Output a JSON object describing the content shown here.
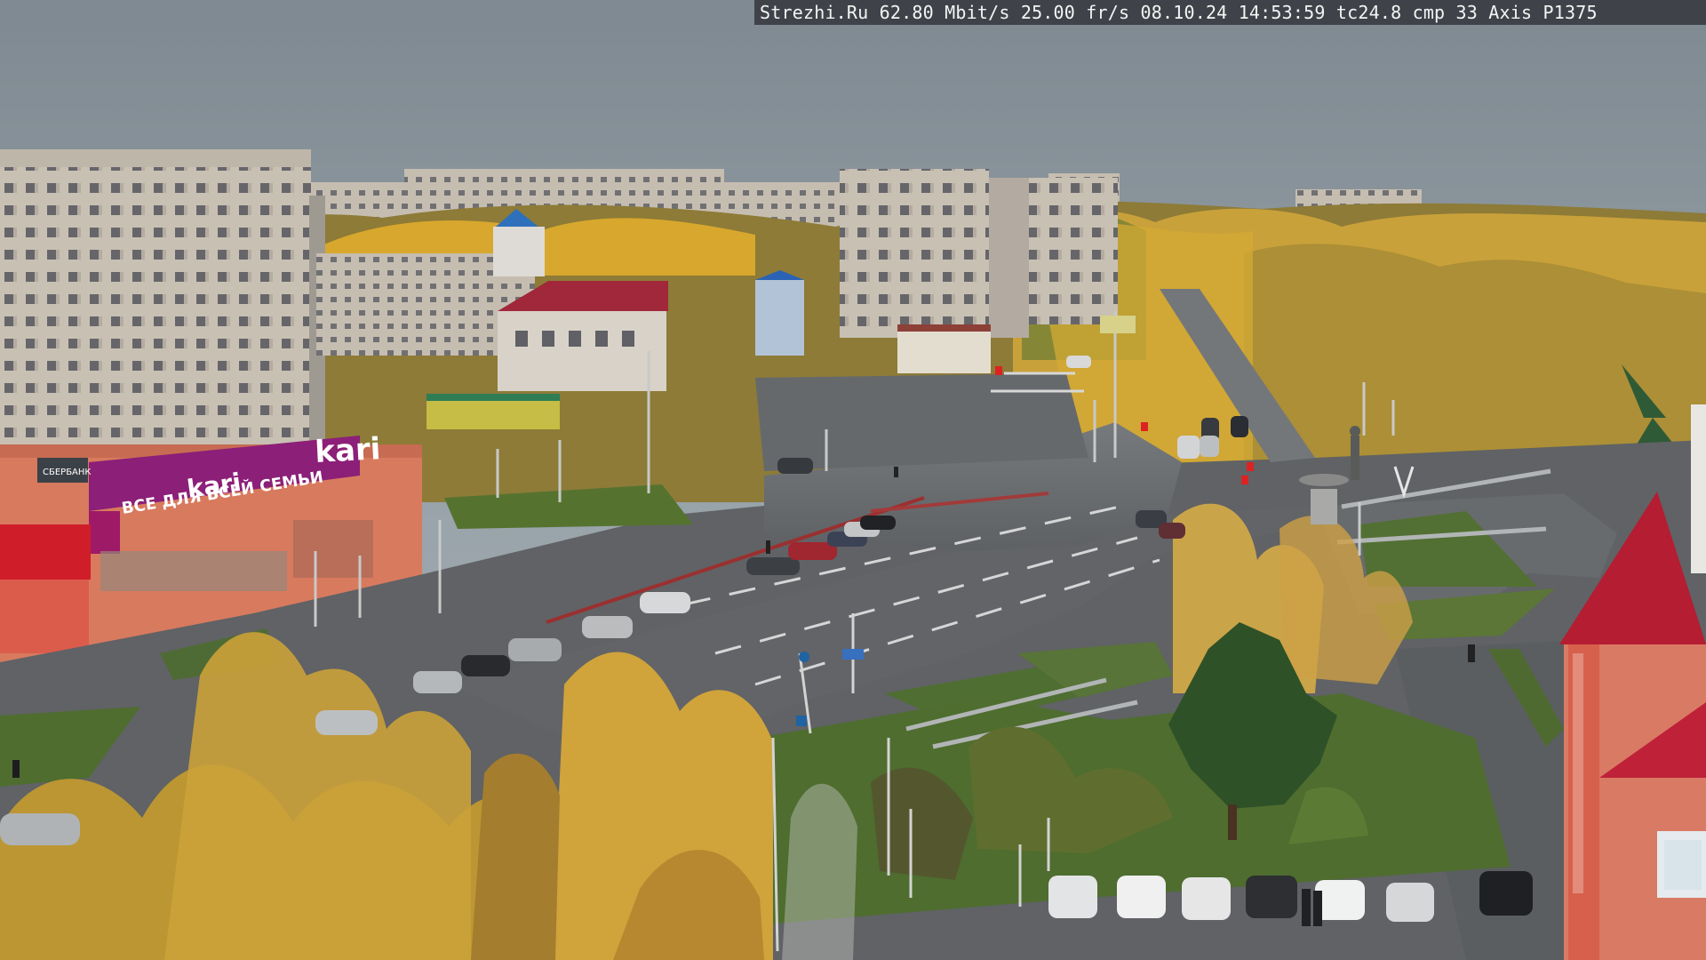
{
  "overlay": {
    "site": "Strezhi.Ru",
    "bitrate": "62.80 Mbit/s",
    "frame_rate": "25.00 fr/s",
    "date": "08.10.24",
    "time": "14:53:59",
    "tc": "tc24.8",
    "compression": "cmp 33",
    "camera_model": "Axis P1375"
  },
  "signs": {
    "store_logo": "kari",
    "facade_text": "ВСЕ ДЛЯ ВСЕЙ СЕМЬИ",
    "store_name_repeat": "kari",
    "bank_sign": "СБЕРБАНК"
  },
  "colors": {
    "sky": "#8f9aa2",
    "autumn_yellow": "#d8a72d",
    "road": "#6b6d70",
    "grass": "#4e6d2f",
    "roof_red": "#a0283a",
    "kari_purple": "#8c1f78"
  }
}
